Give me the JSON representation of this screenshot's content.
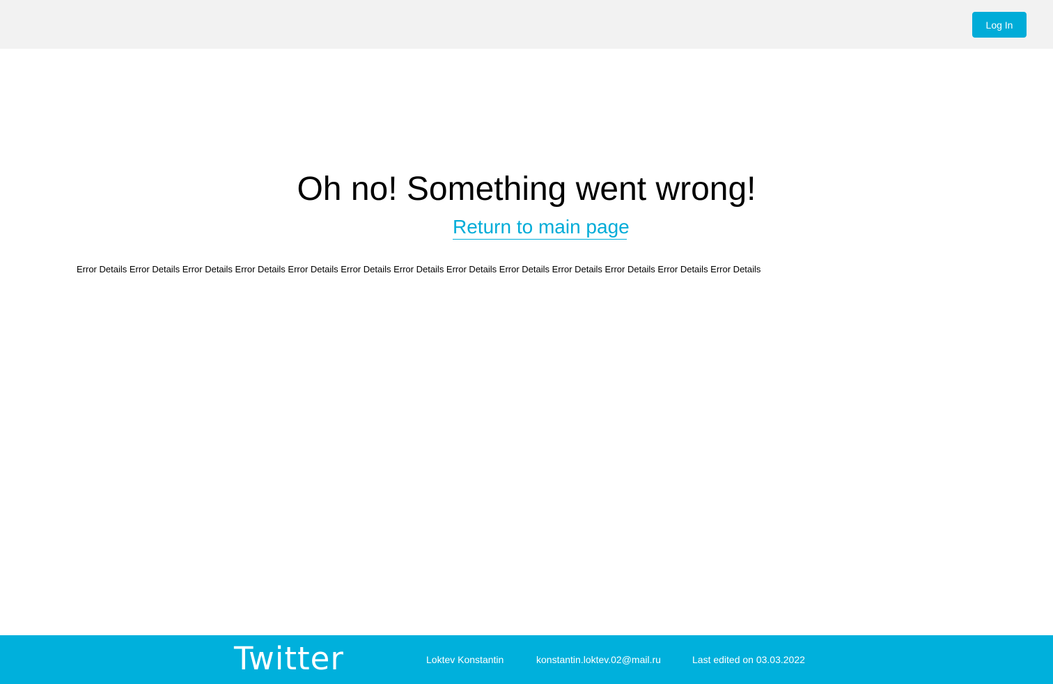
{
  "header": {
    "login_label": "Log In"
  },
  "main": {
    "title": "Oh no! Something went wrong!",
    "return_link": "Return to main page",
    "error_details": "Error Details Error Details Error Details Error Details Error Details Error Details Error Details Error Details Error Details Error Details Error Details Error Details Error Details"
  },
  "footer": {
    "logo": "Twitter",
    "author": "Loktev Konstantin",
    "email": "konstantin.loktev.02@mail.ru",
    "last_edited": "Last edited on 03.03.2022"
  },
  "colors": {
    "accent": "#00acd8",
    "header_bg": "#f2f2f2",
    "footer_bg": "#00b0dc"
  }
}
